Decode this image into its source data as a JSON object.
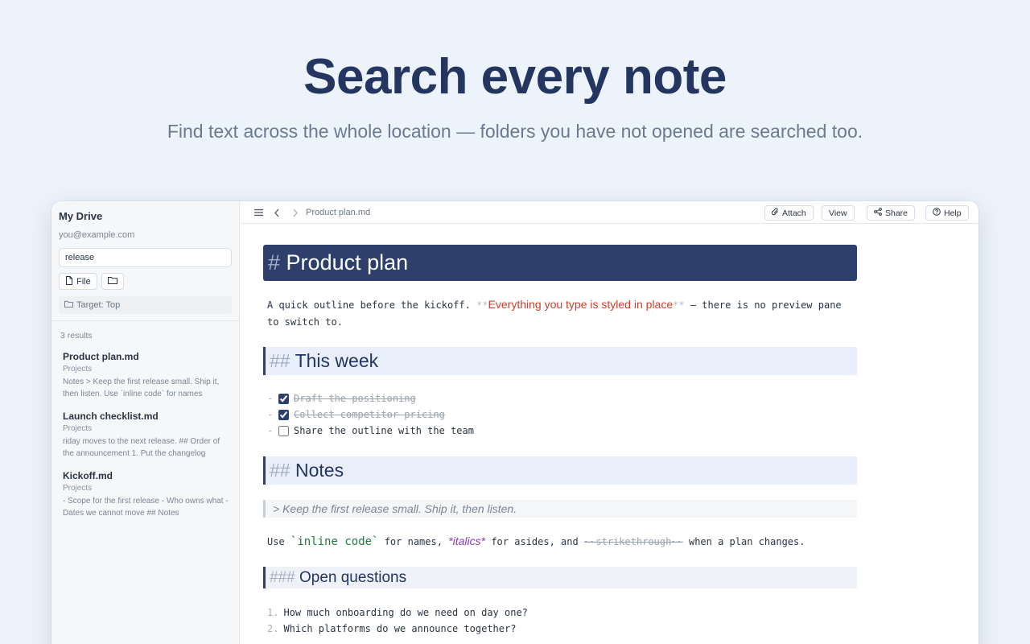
{
  "hero": {
    "title": "Search every note",
    "subtitle": "Find text across the whole location — folders you have not opened are searched too."
  },
  "sidebar": {
    "title": "My Drive",
    "email": "you@example.com",
    "search_value": "release",
    "file_button": "File",
    "target": "Target: Top",
    "results_count": "3 results",
    "results": [
      {
        "title": "Product plan.md",
        "folder": "Projects",
        "snippet": "Notes > Keep the first release small. Ship it, then listen. Use `inline code` for names"
      },
      {
        "title": "Launch checklist.md",
        "folder": "Projects",
        "snippet": "riday moves to the next release. ## Order of the announcement 1. Put the changelog"
      },
      {
        "title": "Kickoff.md",
        "folder": "Projects",
        "snippet": "- Scope for the first release - Who owns what - Dates we cannot move ## Notes"
      }
    ]
  },
  "toolbar": {
    "breadcrumb": "Product plan.md",
    "attach": "Attach",
    "view": "View",
    "share": "Share",
    "help": "Help"
  },
  "doc": {
    "h1_mark": "#",
    "h1": "Product plan",
    "p1_start": "A quick outline before the kickoff. ",
    "bold_mark": "**",
    "p1_bold": "Everything you type is styled in place",
    "p1_end": " — there is no preview pane to switch to.",
    "h2_mark": "##",
    "h2_week": "This week",
    "tasks": [
      {
        "text": "Draft the positioning",
        "done": true
      },
      {
        "text": "Collect competitor pricing",
        "done": true
      },
      {
        "text": "Share the outline with the team",
        "done": false
      }
    ],
    "task_dash": "-",
    "h2_notes": "Notes",
    "quote": "> Keep the first release small. Ship it, then listen.",
    "p2_use": "Use ",
    "p2_code": "`inline code`",
    "p2_mid1": " for names, ",
    "p2_italic": "*italics*",
    "p2_mid2": " for asides, and ",
    "p2_strike": "~~strikethrough~~",
    "p2_end": " when a plan changes.",
    "h3_mark": "###",
    "h3": "Open questions",
    "questions": [
      {
        "n": "1.",
        "text": "How much onboarding do we need on day one?"
      },
      {
        "n": "2.",
        "text": "Which platforms do we announce together?"
      }
    ]
  }
}
